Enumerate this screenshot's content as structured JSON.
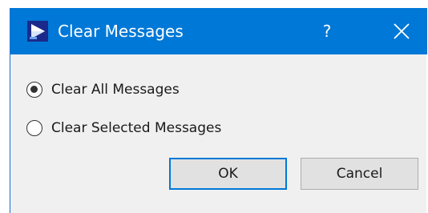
{
  "window": {
    "title": "Clear Messages",
    "help_label": "?"
  },
  "options": [
    {
      "label": "Clear All Messages",
      "selected": true
    },
    {
      "label": "Clear Selected Messages",
      "selected": false
    }
  ],
  "buttons": {
    "ok_label": "OK",
    "cancel_label": "Cancel"
  },
  "colors": {
    "titlebar": "#0078d7",
    "dialog_bg": "#f0f0f0",
    "default_button_border": "#0078d7"
  },
  "icons": {
    "app": "app-logo-icon",
    "close": "close-icon"
  }
}
